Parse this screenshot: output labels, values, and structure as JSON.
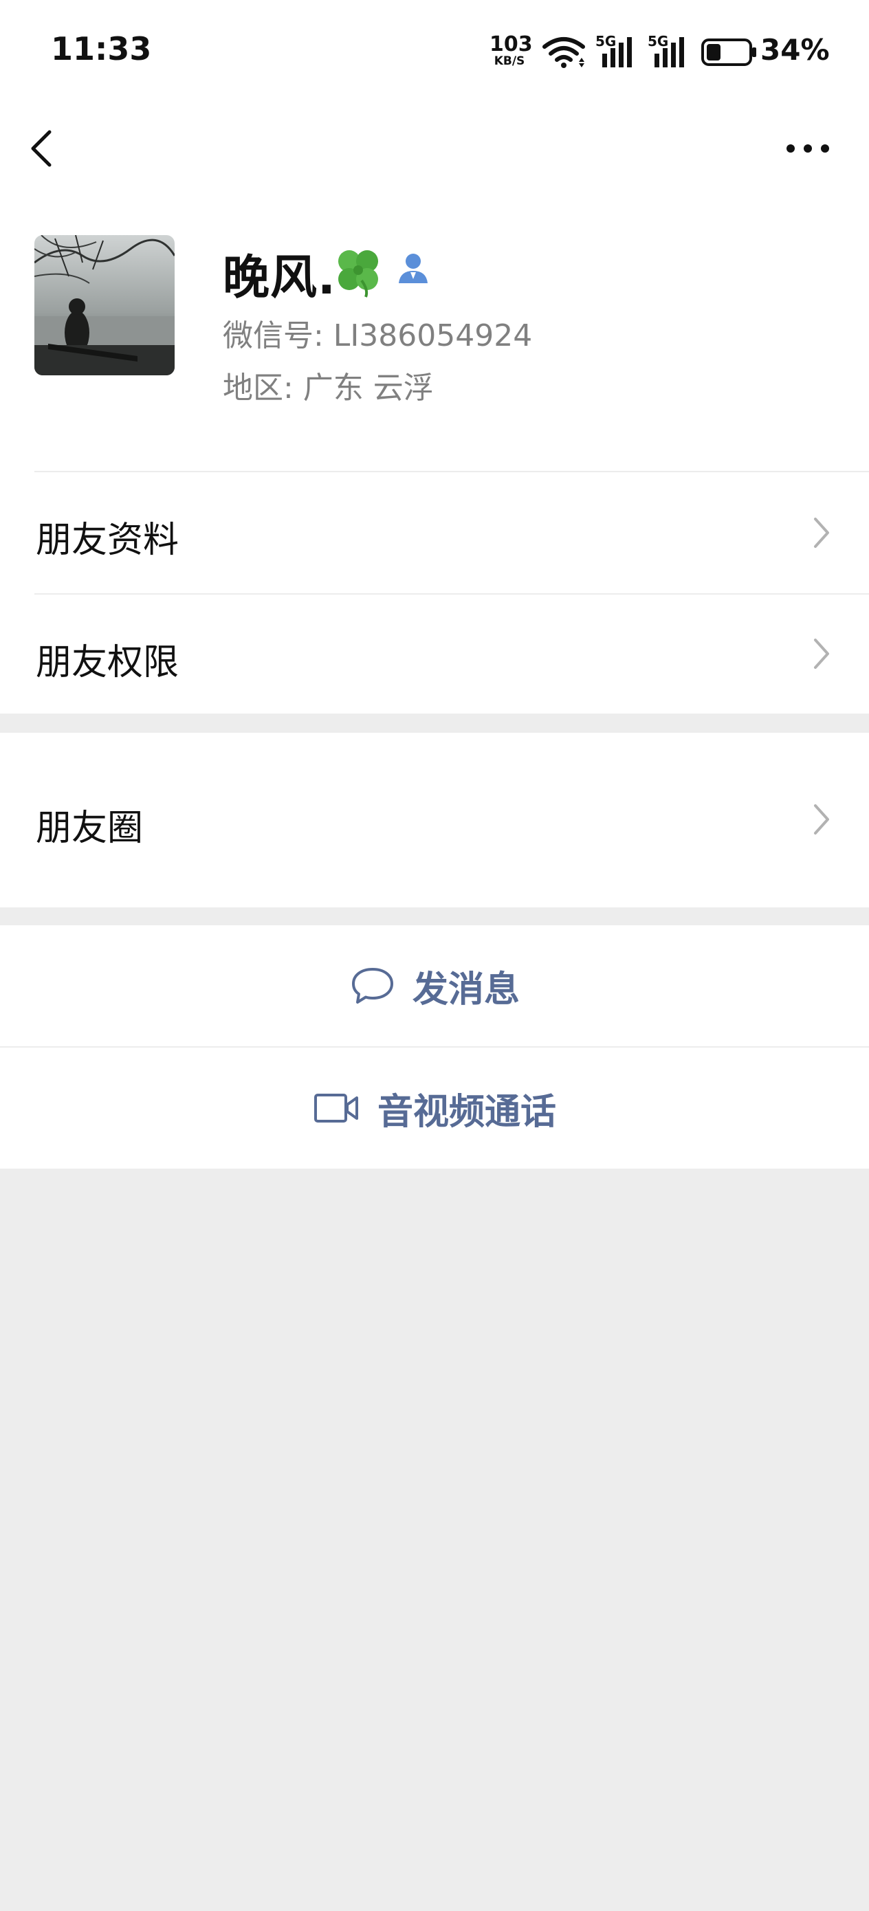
{
  "status_bar": {
    "time": "11:33",
    "net_speed_value": "103",
    "net_speed_unit": "KB/S",
    "network_1": "5G",
    "network_2": "5G",
    "battery_percent": "34%",
    "battery_level": 0.34
  },
  "nav": {
    "back_icon": "chevron-left-icon",
    "more_icon": "more-dots-icon"
  },
  "profile": {
    "nickname": "晚风.",
    "nickname_emoji": "four-leaf-clover-icon",
    "badge_icon": "person-badge-icon",
    "wechat_id": "微信号: LI386054924",
    "region": "地区: 广东  云浮"
  },
  "menu": {
    "friend_info": "朋友资料",
    "friend_permissions": "朋友权限",
    "moments": "朋友圈"
  },
  "actions": {
    "send_message": "发消息",
    "av_call": "音视频通话"
  },
  "colors": {
    "link_blue": "#576b95",
    "page_bg": "#ededed",
    "secondary_text": "#808080"
  }
}
